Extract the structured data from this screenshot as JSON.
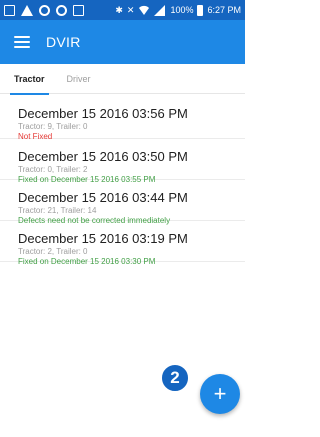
{
  "status_bar": {
    "battery": "100%",
    "time": "6:27 PM"
  },
  "app_bar": {
    "menu_icon": "hamburger-menu-icon",
    "title": "DVIR"
  },
  "tabs": [
    {
      "label": "Tractor",
      "active": true
    },
    {
      "label": "Driver",
      "active": false
    }
  ],
  "records": [
    {
      "date": "December 15 2016 03:56 PM",
      "details": "Tractor: 9, Trailer: 0",
      "status": "Not Fixed",
      "status_color": "#e53935"
    },
    {
      "date": "December 15 2016 03:50 PM",
      "details": "Tractor: 0, Trailer: 2",
      "status": "Fixed on December 15 2016 03:55 PM",
      "status_color": "#43a047"
    },
    {
      "date": "December 15 2016 03:44 PM",
      "details": "Tractor: 21, Trailer: 14",
      "status": "Defects need not be corrected immediately",
      "status_color": "#43a047"
    },
    {
      "date": "December 15 2016 03:19 PM",
      "details": "Tractor: 2, Trailer: 0",
      "status": "Fixed on December 15 2016 03:30 PM",
      "status_color": "#43a047"
    }
  ],
  "fab": {
    "icon": "plus-icon",
    "label": "+"
  },
  "callout": {
    "label": "2"
  },
  "colors": {
    "primary": "#1e88e5",
    "status_bar": "#1565c0"
  }
}
